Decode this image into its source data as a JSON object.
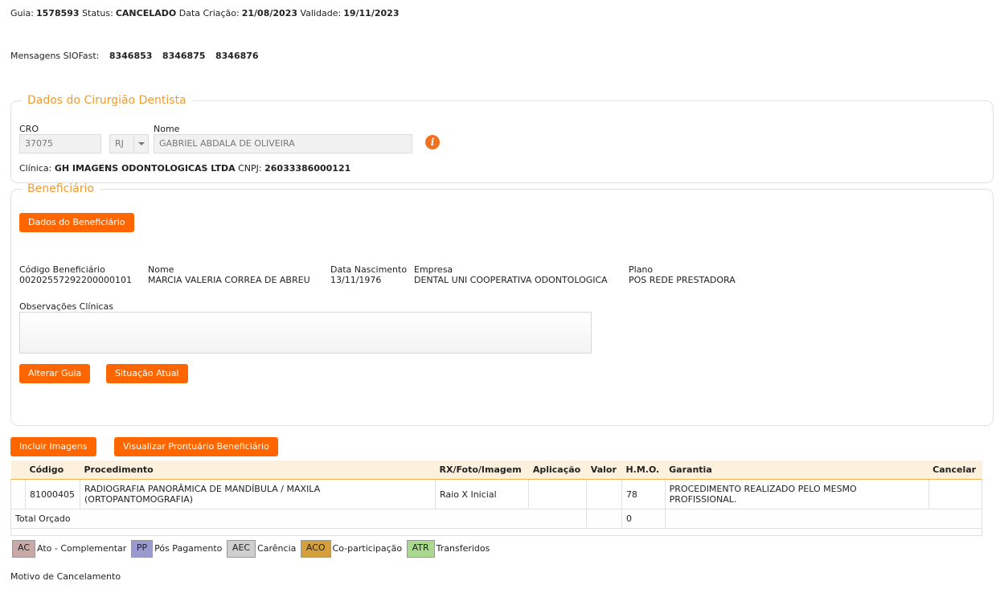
{
  "guide": {
    "guia_label": "Guia:",
    "guia_value": "1578593",
    "status_label": "Status:",
    "status_value": "CANCELADO",
    "creation_label": "Data Criação:",
    "creation_value": "21/08/2023",
    "validity_label": "Validade:",
    "validity_value": "19/11/2023"
  },
  "messages": {
    "label": "Mensagens SIOFast:",
    "ids": [
      "8346853",
      "8346875",
      "8346876"
    ]
  },
  "dentist": {
    "legend": "Dados do Cirurgião Dentista",
    "cro_label": "CRO",
    "cro_value": "37075",
    "uf_value": "RJ",
    "name_label": "Nome",
    "name_value": "GABRIEL ABDALA DE OLIVEIRA",
    "info_glyph": "i",
    "clinic_label": "Clínica:",
    "clinic_value": "GH IMAGENS ODONTOLOGICAS LTDA",
    "cnpj_label": "CNPJ:",
    "cnpj_value": "26033386000121"
  },
  "beneficiary": {
    "legend": "Beneficiário",
    "data_button": "Dados do Beneficiário",
    "code_label": "Código Beneficiário",
    "code_value": "00202557292200000101",
    "name_label": "Nome",
    "name_value": "MARCIA VALERIA CORREA DE ABREU",
    "birth_label": "Data Nascimento",
    "birth_value": "13/11/1976",
    "company_label": "Empresa",
    "company_value": "DENTAL UNI COOPERATIVA ODONTOLOGICA",
    "plan_label": "Plano",
    "plan_value": "POS REDE PRESTADORA",
    "obs_label": "Observações Clínicas",
    "obs_value": "",
    "alter_button": "Alterar Guia",
    "status_button": "Situação Atual"
  },
  "actions": {
    "include_images": "Incluir Imagens",
    "view_record": "Visualizar Prontuário Beneficiário"
  },
  "procedures": {
    "headers": [
      "",
      "Código",
      "Procedimento",
      "RX/Foto/Imagem",
      "Aplicação",
      "Valor",
      "H.M.O.",
      "Garantia",
      "Cancelar"
    ],
    "rows": [
      {
        "code": "81000405",
        "procedure": "RADIOGRAFIA PANORÂMICA DE MANDÍBULA / MAXILA (ORTOPANTOMOGRAFIA)",
        "rx": "Raio X Inicial",
        "application": "",
        "value": "",
        "hmo": "78",
        "guarantee": "PROCEDIMENTO REALIZADO PELO MESMO PROFISSIONAL.",
        "cancel": ""
      }
    ],
    "total_label": "Total Orçado",
    "total_value": "",
    "total_hmo": "0"
  },
  "legend": [
    {
      "code": "AC",
      "label": "Ato - Complementar",
      "color": "#c9a8a8"
    },
    {
      "code": "PP",
      "label": "Pós Pagamento",
      "color": "#9a9ad0"
    },
    {
      "code": "AEC",
      "label": "Carência",
      "color": "#cfcfcf"
    },
    {
      "code": "ACO",
      "label": "Co-participação",
      "color": "#d4a03c"
    },
    {
      "code": "ATR",
      "label": "Transferidos",
      "color": "#a9d98e"
    }
  ],
  "cancel_reason_label": "Motivo de Cancelamento"
}
